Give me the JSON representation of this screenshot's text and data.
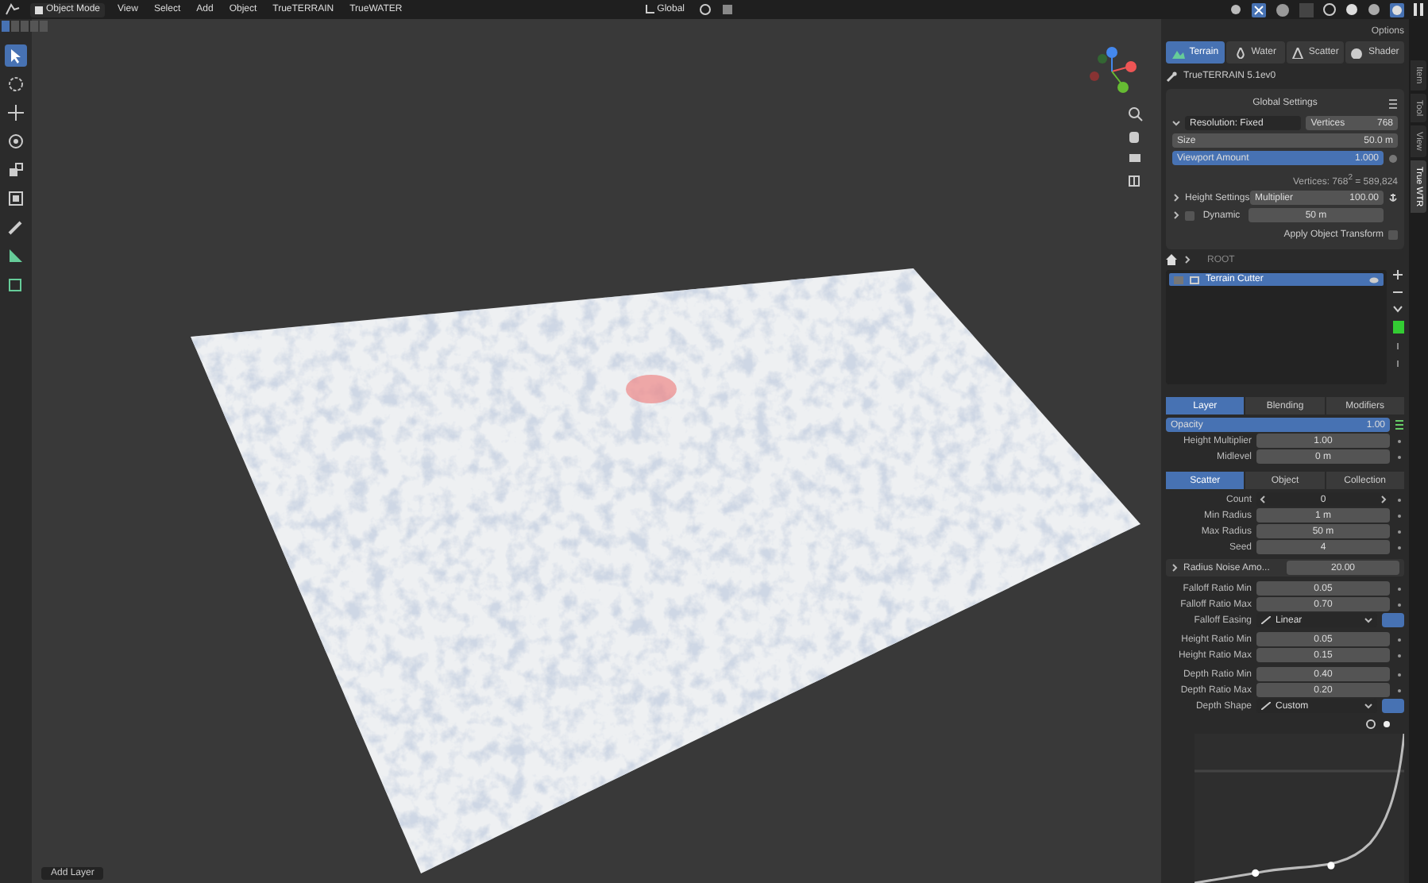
{
  "header": {
    "mode": "Object Mode",
    "menus": [
      "View",
      "Select",
      "Add",
      "Object",
      "TrueTERRAIN",
      "TrueWATER"
    ],
    "orientation": "Global",
    "options": "Options"
  },
  "select_modes": [
    {
      "selected": true
    },
    {
      "selected": false
    },
    {
      "selected": false
    },
    {
      "selected": false
    },
    {
      "selected": false
    }
  ],
  "tools": [
    {
      "kind": "cursor",
      "selected": true
    },
    {
      "kind": "target",
      "selected": false
    },
    {
      "kind": "move",
      "selected": false
    },
    {
      "kind": "rotate",
      "selected": false
    },
    {
      "kind": "scale",
      "selected": false
    },
    {
      "kind": "transform",
      "selected": false
    },
    {
      "kind": "annotate",
      "selected": false
    },
    {
      "kind": "measure",
      "selected": false
    },
    {
      "kind": "cube",
      "selected": false
    }
  ],
  "viewport": {
    "operator_panel": "Add Layer"
  },
  "sidebar_tabs": [
    {
      "label": "Item",
      "selected": false
    },
    {
      "label": "Tool",
      "selected": false
    },
    {
      "label": "View",
      "selected": false
    },
    {
      "label": "True WTR",
      "selected": true
    }
  ],
  "panel": {
    "tabs": [
      {
        "label": "Terrain",
        "kind": "terrain",
        "selected": true
      },
      {
        "label": "Water",
        "kind": "water",
        "selected": false
      },
      {
        "label": "Scatter",
        "kind": "scatter",
        "selected": false
      },
      {
        "label": "Shader",
        "kind": "shader",
        "selected": false
      }
    ],
    "addon_title": "TrueTERRAIN 5.1ev0",
    "global_settings": {
      "title": "Global Settings",
      "resolution": "Resolution: Fixed",
      "vertices_label": "Vertices",
      "vertices_value": "768",
      "size_label": "Size",
      "size_value": "50.0 m",
      "viewport_amount": {
        "label": "Viewport Amount",
        "value": "1.000",
        "level": 1
      },
      "vertices_info": "Vertices: 768$^{2}$ = 589,824",
      "height_settings": "Height Settings",
      "multiplier_label": "Multiplier",
      "multiplier_value": "100.00",
      "dynamic": {
        "label": "Dynamic",
        "checked": false,
        "value": "50 m"
      },
      "apply_transform": {
        "label": "Apply Object Transform",
        "checked": false
      }
    },
    "breadcrumb": "ROOT",
    "layers": [
      {
        "name": "Terrain Cutter",
        "selected": true
      }
    ],
    "layer_tabs": [
      {
        "label": "Layer",
        "selected": true
      },
      {
        "label": "Blending",
        "selected": false
      },
      {
        "label": "Modifiers",
        "selected": false
      }
    ],
    "layer_fields": [
      {
        "kind": "slider",
        "label": "Opacity",
        "value": "1.00",
        "level": 1
      },
      {
        "kind": "number",
        "label": "Height Multiplier",
        "value": "1.00"
      },
      {
        "kind": "number",
        "label": "Midlevel",
        "value": "0 m"
      }
    ],
    "scatter_tabs": [
      {
        "label": "Scatter",
        "selected": true
      },
      {
        "label": "Object",
        "selected": false
      },
      {
        "label": "Collection",
        "selected": false
      }
    ],
    "scatter_groups": [
      [
        {
          "kind": "counter",
          "label": "Count",
          "value": "0"
        },
        {
          "kind": "number",
          "label": "Min Radius",
          "value": "1 m"
        },
        {
          "kind": "number",
          "label": "Max Radius",
          "value": "50 m"
        },
        {
          "kind": "number",
          "label": "Seed",
          "value": "4"
        }
      ],
      [
        {
          "kind": "subpanel",
          "label": "Radius Noise Amo...",
          "value": "20.00"
        }
      ],
      [
        {
          "kind": "number",
          "label": "Falloff Ratio Min",
          "value": "0.05"
        },
        {
          "kind": "number",
          "label": "Falloff Ratio Max",
          "value": "0.70"
        },
        {
          "kind": "dropdown",
          "label": "Falloff Easing",
          "value": "Linear"
        }
      ],
      [
        {
          "kind": "number",
          "label": "Height Ratio Min",
          "value": "0.05"
        },
        {
          "kind": "number",
          "label": "Height Ratio Max",
          "value": "0.15"
        }
      ],
      [
        {
          "kind": "number",
          "label": "Depth Ratio Min",
          "value": "0.40"
        },
        {
          "kind": "number",
          "label": "Depth Ratio Max",
          "value": "0.20"
        },
        {
          "kind": "dropdown",
          "label": "Depth Shape",
          "value": "Custom"
        }
      ]
    ]
  }
}
